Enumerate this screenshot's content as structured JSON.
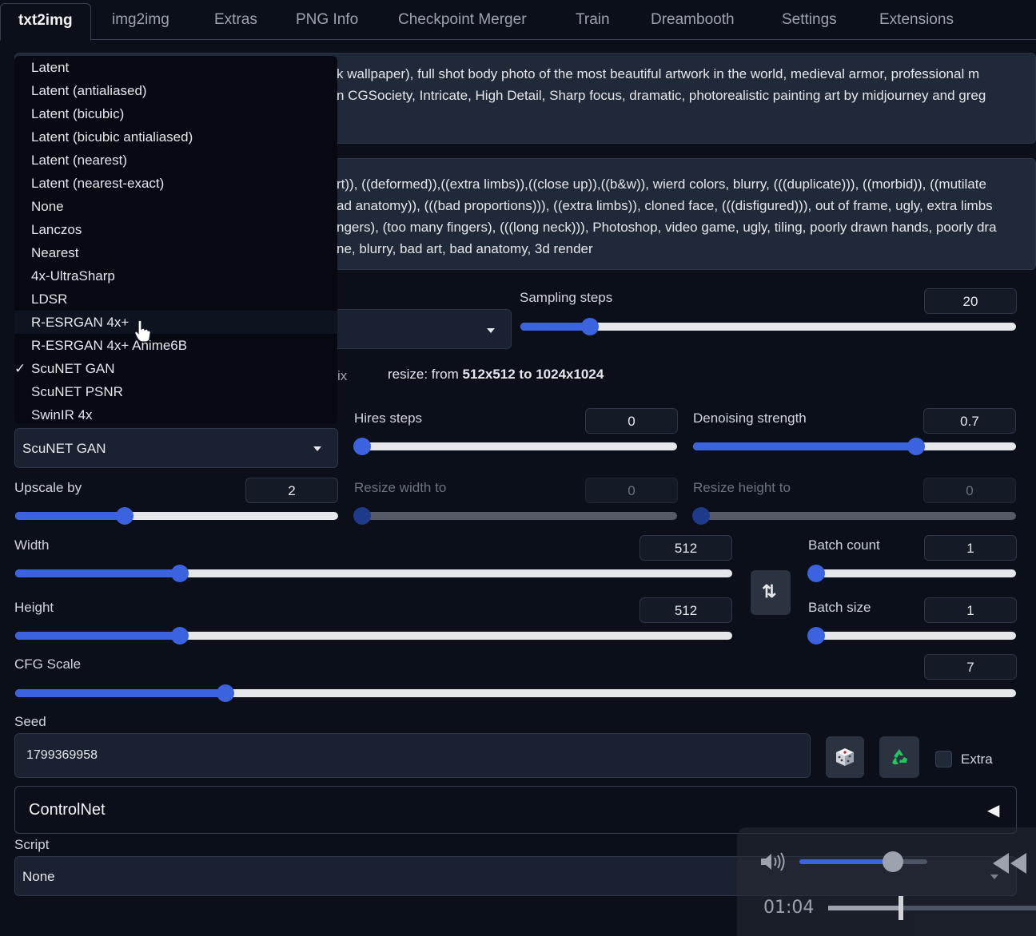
{
  "tabs": [
    "txt2img",
    "img2img",
    "Extras",
    "PNG Info",
    "Checkpoint Merger",
    "Train",
    "Dreambooth",
    "Settings",
    "Extensions"
  ],
  "prompt": {
    "lines": [
      "k wallpaper), full shot body photo of the most beautiful artwork in the world, medieval armor, professional m",
      "n CGSociety, Intricate, High Detail, Sharp focus, dramatic, photorealistic painting art by midjourney and greg"
    ]
  },
  "negative_prompt": {
    "lines": [
      "rt)), ((deformed)),((extra limbs)),((close up)),((b&w)), wierd colors, blurry, (((duplicate))), ((morbid)), ((mutilate",
      "ad anatomy)), (((bad proportions))), ((extra limbs)), cloned face, (((disfigured))), out of frame, ugly, extra limbs",
      "ngers), (too many fingers), (((long neck))), Photoshop, video game, ugly, tiling, poorly drawn hands, poorly dra",
      "ne, blurry, bad art, bad anatomy, 3d render"
    ]
  },
  "upscaler_menu": {
    "options": [
      "Latent",
      "Latent (antialiased)",
      "Latent (bicubic)",
      "Latent (bicubic antialiased)",
      "Latent (nearest)",
      "Latent (nearest-exact)",
      "None",
      "Lanczos",
      "Nearest",
      "4x-UltraSharp",
      "LDSR",
      "R-ESRGAN 4x+",
      "R-ESRGAN 4x+ Anime6B",
      "ScuNET GAN",
      "ScuNET PSNR",
      "SwinIR 4x"
    ],
    "selected": "ScuNET GAN",
    "check": "✓",
    "hovered": "R-ESRGAN 4x+"
  },
  "sampling_steps": {
    "label": "Sampling steps",
    "value": "20",
    "fraction": 0.14
  },
  "hires": {
    "fix_fragment": "ix",
    "resize_prefix": "resize: from",
    "resize_text": "512x512 to 1024x1024",
    "upscaler_value": "ScuNET GAN",
    "steps": {
      "label": "Hires steps",
      "value": "0",
      "fraction": 0.0
    },
    "denoising": {
      "label": "Denoising strength",
      "value": "0.7",
      "fraction": 0.69
    },
    "upscale_by": {
      "label": "Upscale by",
      "value": "2",
      "fraction": 0.34
    },
    "resize_width": {
      "label": "Resize width to",
      "value": "0",
      "fraction": 0.0
    },
    "resize_height": {
      "label": "Resize height to",
      "value": "0",
      "fraction": 0.0
    }
  },
  "width": {
    "label": "Width",
    "value": "512",
    "fraction": 0.23
  },
  "height": {
    "label": "Height",
    "value": "512",
    "fraction": 0.23
  },
  "swap_icon": "⇅",
  "batch_count": {
    "label": "Batch count",
    "value": "1",
    "fraction": 0.0
  },
  "batch_size": {
    "label": "Batch size",
    "value": "1",
    "fraction": 0.0
  },
  "cfg_scale": {
    "label": "CFG Scale",
    "value": "7",
    "fraction": 0.21
  },
  "seed": {
    "label": "Seed",
    "value": "1799369958",
    "extra_label": "Extra",
    "dice_icon": "dice-icon",
    "recycle_icon": "recycle-icon",
    "recycle_color": "#22c55e"
  },
  "controlnet": {
    "label": "ControlNet",
    "collapse_glyph": "◀"
  },
  "script": {
    "label": "Script",
    "value": "None"
  },
  "video_overlay": {
    "time": "01:04",
    "volume": 0.73,
    "progress": 0.35
  },
  "colors": {
    "accent": "#3b63e0",
    "background": "#0b0f19",
    "panel": "#1f2937"
  }
}
